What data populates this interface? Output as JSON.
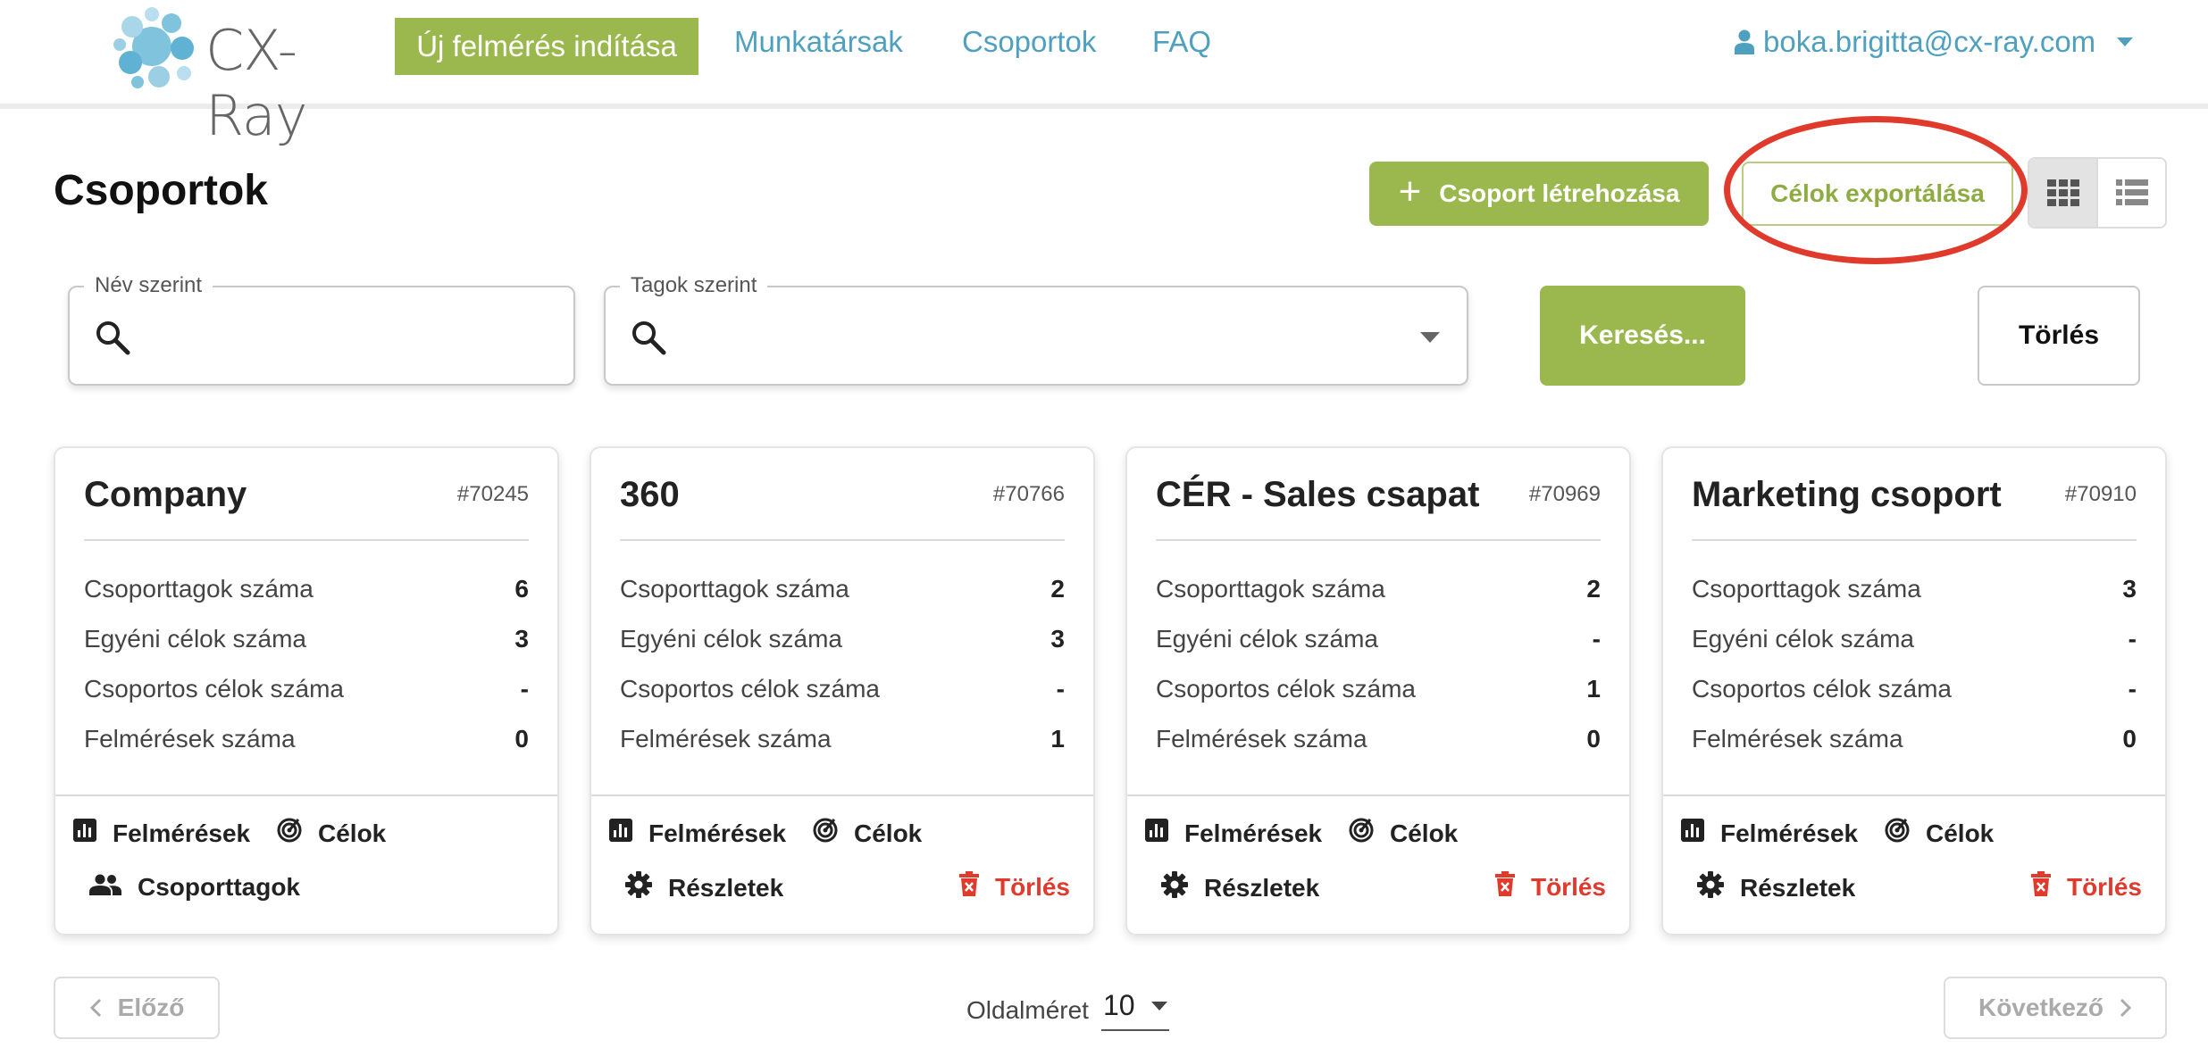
{
  "nav": {
    "logo_text": "CX-Ray",
    "new_survey": "Új felmérés indítása",
    "links": [
      "Munkatársak",
      "Csoportok",
      "FAQ"
    ],
    "user_email": "boka.brigitta@cx-ray.com"
  },
  "header": {
    "title": "Csoportok",
    "create_button": "Csoport létrehozása",
    "export_button": "Célok exportálása"
  },
  "filters": {
    "name_label": "Név szerint",
    "name_value": "",
    "members_label": "Tagok szerint",
    "members_value": "",
    "search_button": "Keresés...",
    "clear_button": "Törlés"
  },
  "stat_labels": [
    "Csoporttagok száma",
    "Egyéni célok száma",
    "Csoportos célok száma",
    "Felmérések száma"
  ],
  "actions": {
    "surveys": "Felmérések",
    "goals": "Célok",
    "members": "Csoporttagok",
    "details": "Részletek",
    "delete": "Törlés"
  },
  "cards": [
    {
      "name": "Company",
      "id": "#70245",
      "stats": [
        "6",
        "3",
        "-",
        "0"
      ]
    },
    {
      "name": "360",
      "id": "#70766",
      "stats": [
        "2",
        "3",
        "-",
        "1"
      ]
    },
    {
      "name": "CÉR - Sales csapat",
      "id": "#70969",
      "stats": [
        "2",
        "-",
        "1",
        "0"
      ]
    },
    {
      "name": "Marketing csoport",
      "id": "#70910",
      "stats": [
        "3",
        "-",
        "-",
        "0"
      ]
    }
  ],
  "pagination": {
    "prev": "Előző",
    "next": "Következő",
    "page_size_label": "Oldalméret",
    "page_size": "10"
  },
  "colors": {
    "brand_green": "#9bb84f",
    "link_blue": "#4fa0bf",
    "danger_red": "#e03a2c",
    "annotation_red": "#e03a2c"
  }
}
